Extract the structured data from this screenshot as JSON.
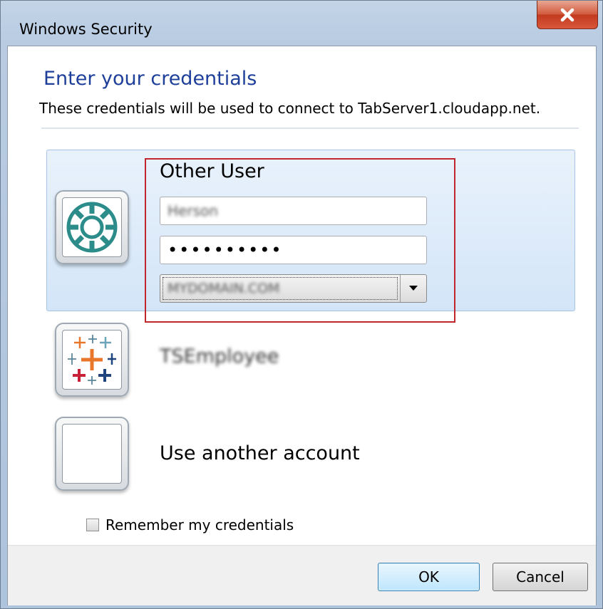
{
  "window": {
    "title": "Windows Security",
    "close_icon": "close-icon"
  },
  "dialog": {
    "heading": "Enter your credentials",
    "subtext": "These credentials will be used to connect to TabServer1.cloudapp.net."
  },
  "selected_account": {
    "name": "Other User",
    "icon": "gear-icon",
    "username_value": "Herson",
    "password_value": "••••••••••",
    "domain_value": "MYDOMAIN.COM"
  },
  "accounts": [
    {
      "label": "TSEmployee",
      "icon": "tableau-logo-icon"
    },
    {
      "label": "Use another account",
      "icon": "blank-user-icon"
    }
  ],
  "remember": {
    "label": "Remember my credentials",
    "checked": false
  },
  "buttons": {
    "ok": "OK",
    "cancel": "Cancel"
  },
  "colors": {
    "heading": "#1e3f9a",
    "highlight": "#c0262c",
    "gear": "#2b8c8a"
  }
}
